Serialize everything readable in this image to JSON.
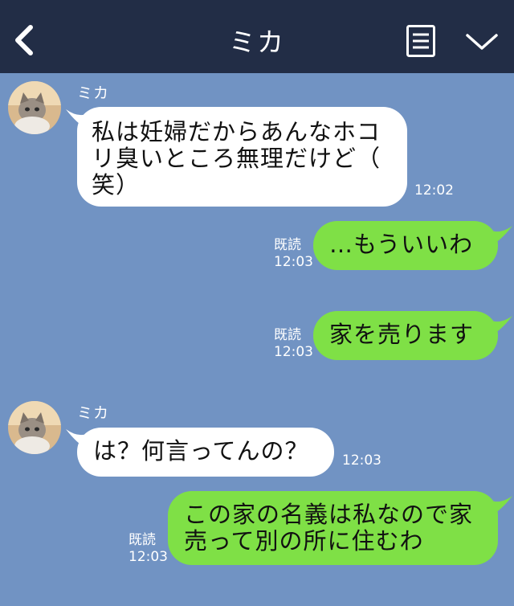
{
  "header": {
    "title": "ミカ"
  },
  "messages": [
    {
      "sender": "ミカ",
      "text": "私は妊婦だからあんなホコ\nリ臭いところ無理だけど（\n笑）",
      "time": "12:02"
    },
    {
      "read": "既読",
      "time": "12:03",
      "text": "…もういいわ"
    },
    {
      "read": "既読",
      "time": "12:03",
      "text": "家を売ります"
    },
    {
      "sender": "ミカ",
      "text": "は？何言ってんの？",
      "time": "12:03"
    },
    {
      "read": "既読",
      "time": "12:03",
      "text": "この家の名義は私なので家\n売って別の所に住むわ"
    }
  ],
  "colors": {
    "header": "#222d46",
    "background": "#7193c3",
    "outgoing": "#7fe046",
    "incoming": "#ffffff"
  },
  "icons": {
    "back": "back-chevron-icon",
    "menu": "menu-lines-icon",
    "expand": "chevron-down-icon",
    "avatar": "cat-avatar"
  }
}
